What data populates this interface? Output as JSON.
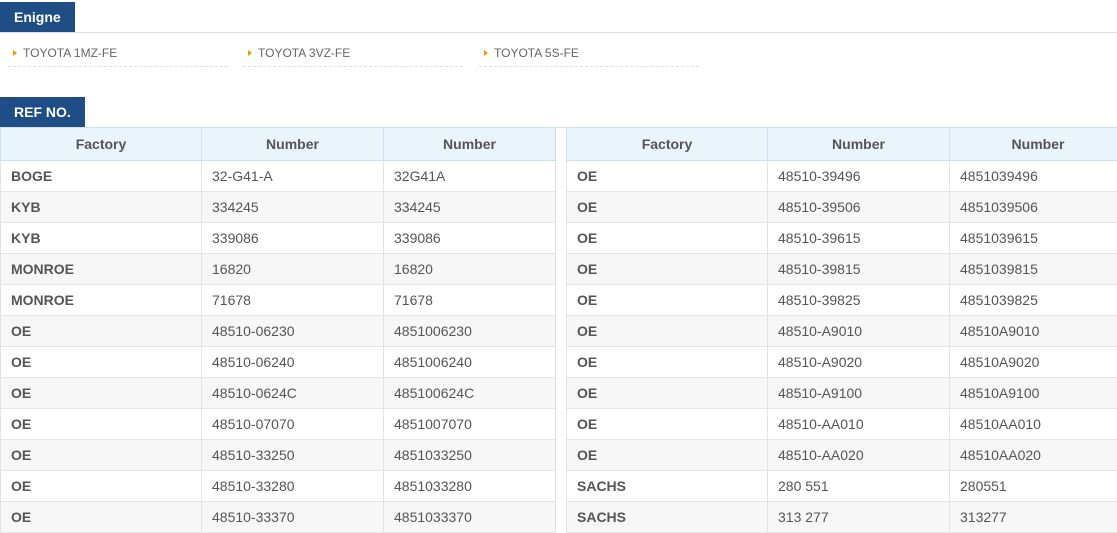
{
  "engine_section": {
    "title": "Enigne",
    "items": [
      "TOYOTA 1MZ-FE",
      "TOYOTA 3VZ-FE",
      "TOYOTA 5S-FE"
    ]
  },
  "ref_section": {
    "title": "REF NO.",
    "columns": [
      "Factory",
      "Number",
      "Number"
    ],
    "left_rows": [
      [
        "BOGE",
        "32-G41-A",
        "32G41A"
      ],
      [
        "KYB",
        "334245",
        "334245"
      ],
      [
        "KYB",
        "339086",
        "339086"
      ],
      [
        "MONROE",
        "16820",
        "16820"
      ],
      [
        "MONROE",
        "71678",
        "71678"
      ],
      [
        "OE",
        "48510-06230",
        "4851006230"
      ],
      [
        "OE",
        "48510-06240",
        "4851006240"
      ],
      [
        "OE",
        "48510-0624C",
        "485100624C"
      ],
      [
        "OE",
        "48510-07070",
        "4851007070"
      ],
      [
        "OE",
        "48510-33250",
        "4851033250"
      ],
      [
        "OE",
        "48510-33280",
        "4851033280"
      ],
      [
        "OE",
        "48510-33370",
        "4851033370"
      ]
    ],
    "right_rows": [
      [
        "OE",
        "48510-39496",
        "4851039496"
      ],
      [
        "OE",
        "48510-39506",
        "4851039506"
      ],
      [
        "OE",
        "48510-39615",
        "4851039615"
      ],
      [
        "OE",
        "48510-39815",
        "4851039815"
      ],
      [
        "OE",
        "48510-39825",
        "4851039825"
      ],
      [
        "OE",
        "48510-A9010",
        "48510A9010"
      ],
      [
        "OE",
        "48510-A9020",
        "48510A9020"
      ],
      [
        "OE",
        "48510-A9100",
        "48510A9100"
      ],
      [
        "OE",
        "48510-AA010",
        "48510AA010"
      ],
      [
        "OE",
        "48510-AA020",
        "48510AA020"
      ],
      [
        "SACHS",
        "280 551",
        "280551"
      ],
      [
        "SACHS",
        "313 277",
        "313277"
      ]
    ]
  },
  "colors": {
    "tab_background": "#1f4e86",
    "header_background": "#eaf4fb",
    "arrow": "#f39800"
  }
}
